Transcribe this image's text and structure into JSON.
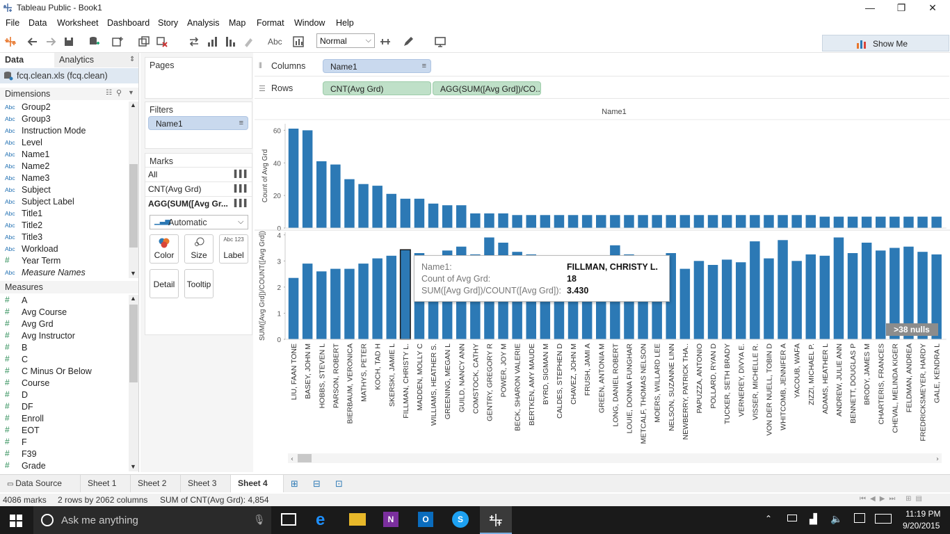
{
  "window": {
    "title": "Tableau Public - Book1",
    "minimize": "—",
    "restore": "❐",
    "close": "✕"
  },
  "menu": [
    "File",
    "Data",
    "Worksheet",
    "Dashboard",
    "Story",
    "Analysis",
    "Map",
    "Format",
    "Window",
    "Help"
  ],
  "toolbar": {
    "fit_value": "Normal",
    "show_me_label": "Show Me",
    "abc_label": "Abc"
  },
  "left_pane": {
    "tabs": {
      "data": "Data",
      "analytics": "Analytics"
    },
    "datasource": "fcq.clean.xls (fcq.clean)",
    "dimensions_header": "Dimensions",
    "dimensions": [
      {
        "type": "Abc",
        "name": "Group2"
      },
      {
        "type": "Abc",
        "name": "Group3"
      },
      {
        "type": "Abc",
        "name": "Instruction Mode"
      },
      {
        "type": "Abc",
        "name": "Level"
      },
      {
        "type": "Abc",
        "name": "Name1"
      },
      {
        "type": "Abc",
        "name": "Name2"
      },
      {
        "type": "Abc",
        "name": "Name3"
      },
      {
        "type": "Abc",
        "name": "Subject"
      },
      {
        "type": "Abc",
        "name": "Subject Label"
      },
      {
        "type": "Abc",
        "name": "Title1"
      },
      {
        "type": "Abc",
        "name": "Title2"
      },
      {
        "type": "Abc",
        "name": "Title3"
      },
      {
        "type": "Abc",
        "name": "Workload"
      },
      {
        "type": "#",
        "name": "Year Term"
      },
      {
        "type": "Abc",
        "name": "Measure Names"
      }
    ],
    "measures_header": "Measures",
    "measures": [
      "A",
      "Avg Course",
      "Avg Grd",
      "Avg Instructor",
      "B",
      "C",
      "C Minus Or Below",
      "Course",
      "D",
      "DF",
      "Enroll",
      "EOT",
      "F",
      "F39",
      "Grade"
    ]
  },
  "cards": {
    "pages": "Pages",
    "filters": "Filters",
    "filter_pill": "Name1",
    "marks": "Marks",
    "mark_rows": [
      "All",
      "CNT(Avg Grd)",
      "AGG(SUM([Avg Gr..."
    ],
    "mark_type": "Automatic",
    "buttons": {
      "color": "Color",
      "size": "Size",
      "label": "Label",
      "detail": "Detail",
      "tooltip": "Tooltip",
      "label_glyph": "Abc 123"
    }
  },
  "shelves": {
    "columns_label": "Columns",
    "columns_pill": "Name1",
    "rows_label": "Rows",
    "rows_pills": [
      "CNT(Avg Grd)",
      "AGG(SUM([Avg Grd])/CO.."
    ]
  },
  "chart_data": {
    "type": "bar",
    "title": "Name1",
    "null_indicator": ">38 nulls",
    "categories": [
      "LIU, FAAN TONE",
      "BASEY, JOHN M",
      "HOBBS, STEVEN L",
      "PARSON, ROBERT",
      "BIERBAUM, VERONICA",
      "MATHYS, PETER",
      "KOCH, TAD H",
      "SKERSKI, JAMIE L",
      "FILLMAN, CHRISTY L.",
      "MADDEN, MOLLY C",
      "WILLIAMS, HEATHER S.",
      "GREENING, MEGAN L",
      "GUILD, NANCY ANN",
      "COMSTOCK, CATHY",
      "GENTRY, GREGORY R",
      "POWER, JOY M",
      "BECK, SHARON VALERIE",
      "BERTKEN, AMY MAUDE",
      "BYRD, SIGMAN M",
      "CALDES, STEPHEN D",
      "CHAVEZ, JOHN M",
      "FRUSH, JAMI A",
      "GREEN, ANTONIA M",
      "LONG, DANIEL ROBERT",
      "LOUIE, DONNA FUNGHAR",
      "METCALF, THOMAS NELSON",
      "MOERS, WILLARD LEE",
      "NELSON, SUZANNE LINN",
      "NEWBERRY, PATRICK THA..",
      "PAPUZZA, ANTONIO",
      "POLLARD, RYAN D",
      "TUCKER, SETH BRADY",
      "VERNEREY, DIVYA E.",
      "VISSER, MICHELLE R.",
      "VON DER NUELL, TOBIN D",
      "WHITCOMB, JENNIFER A",
      "YACOUB, WAFA",
      "ZIZZI, MICHAEL P.",
      "ADAMS, HEATHER L",
      "ANDREW, JULIE ANN",
      "BENNETT, DOUGLAS P",
      "BRODY, JAMES M",
      "CHARTERIS, FRANCES",
      "CHEVAL, MELINDA KIGER",
      "FELDMAN, ANDREA",
      "FREDRICKSMEYER, HARDY",
      "GALE, KENDRA L"
    ],
    "series": [
      {
        "name": "Count of Avg Grd",
        "ylabel": "Count of Avg Grd",
        "ylim": [
          0,
          64
        ],
        "ticks": [
          0,
          20,
          40,
          60
        ],
        "values": [
          61,
          60,
          41,
          39,
          30,
          27,
          26,
          21,
          18,
          18,
          15,
          14,
          14,
          9,
          9,
          9,
          8,
          8,
          8,
          8,
          8,
          8,
          8,
          8,
          8,
          8,
          8,
          8,
          8,
          8,
          8,
          8,
          8,
          8,
          8,
          8,
          8,
          8,
          7,
          7,
          7,
          7,
          7,
          7,
          7,
          7,
          7
        ]
      },
      {
        "name": "SUM([Avg Grd])/COUNT([Avg Grd])",
        "ylabel": "SUM([Avg Grd])/COUNT([Avg Grd])",
        "ylim": [
          0,
          4.1
        ],
        "ticks": [
          0,
          1,
          2,
          3,
          4
        ],
        "values": [
          2.35,
          2.9,
          2.6,
          2.7,
          2.7,
          2.9,
          3.1,
          3.2,
          3.43,
          3.3,
          3.2,
          3.4,
          3.55,
          3.25,
          3.9,
          3.7,
          3.35,
          3.25,
          3.0,
          3.1,
          3.2,
          3.0,
          3.0,
          3.6,
          3.25,
          3.0,
          3.1,
          3.3,
          2.7,
          3.0,
          2.85,
          3.05,
          2.95,
          3.75,
          3.1,
          3.8,
          3.0,
          3.25,
          3.2,
          3.9,
          3.3,
          3.7,
          3.4,
          3.5,
          3.55,
          3.35,
          3.25
        ]
      }
    ],
    "highlight_index": 8,
    "tooltip": {
      "k1": "Name1:",
      "v1": "FILLMAN, CHRISTY L.",
      "k2": "Count of Avg Grd:",
      "v2": "18",
      "k3": "SUM([Avg Grd])/COUNT([Avg Grd]):",
      "v3": "3.430"
    },
    "bar_color": "#2c79b5",
    "highlight_border": "#1a1a1a"
  },
  "sheet_tabs": {
    "datasource": "Data Source",
    "sheets": [
      "Sheet 1",
      "Sheet 2",
      "Sheet 3",
      "Sheet 4"
    ],
    "active": "Sheet 4"
  },
  "status": {
    "marks": "4086 marks",
    "dims": "2 rows by 2062 columns",
    "sum": "SUM of CNT(Avg Grd): 4,854"
  },
  "taskbar": {
    "search_placeholder": "Ask me anything",
    "time": "11:19 PM",
    "date": "9/20/2015"
  }
}
